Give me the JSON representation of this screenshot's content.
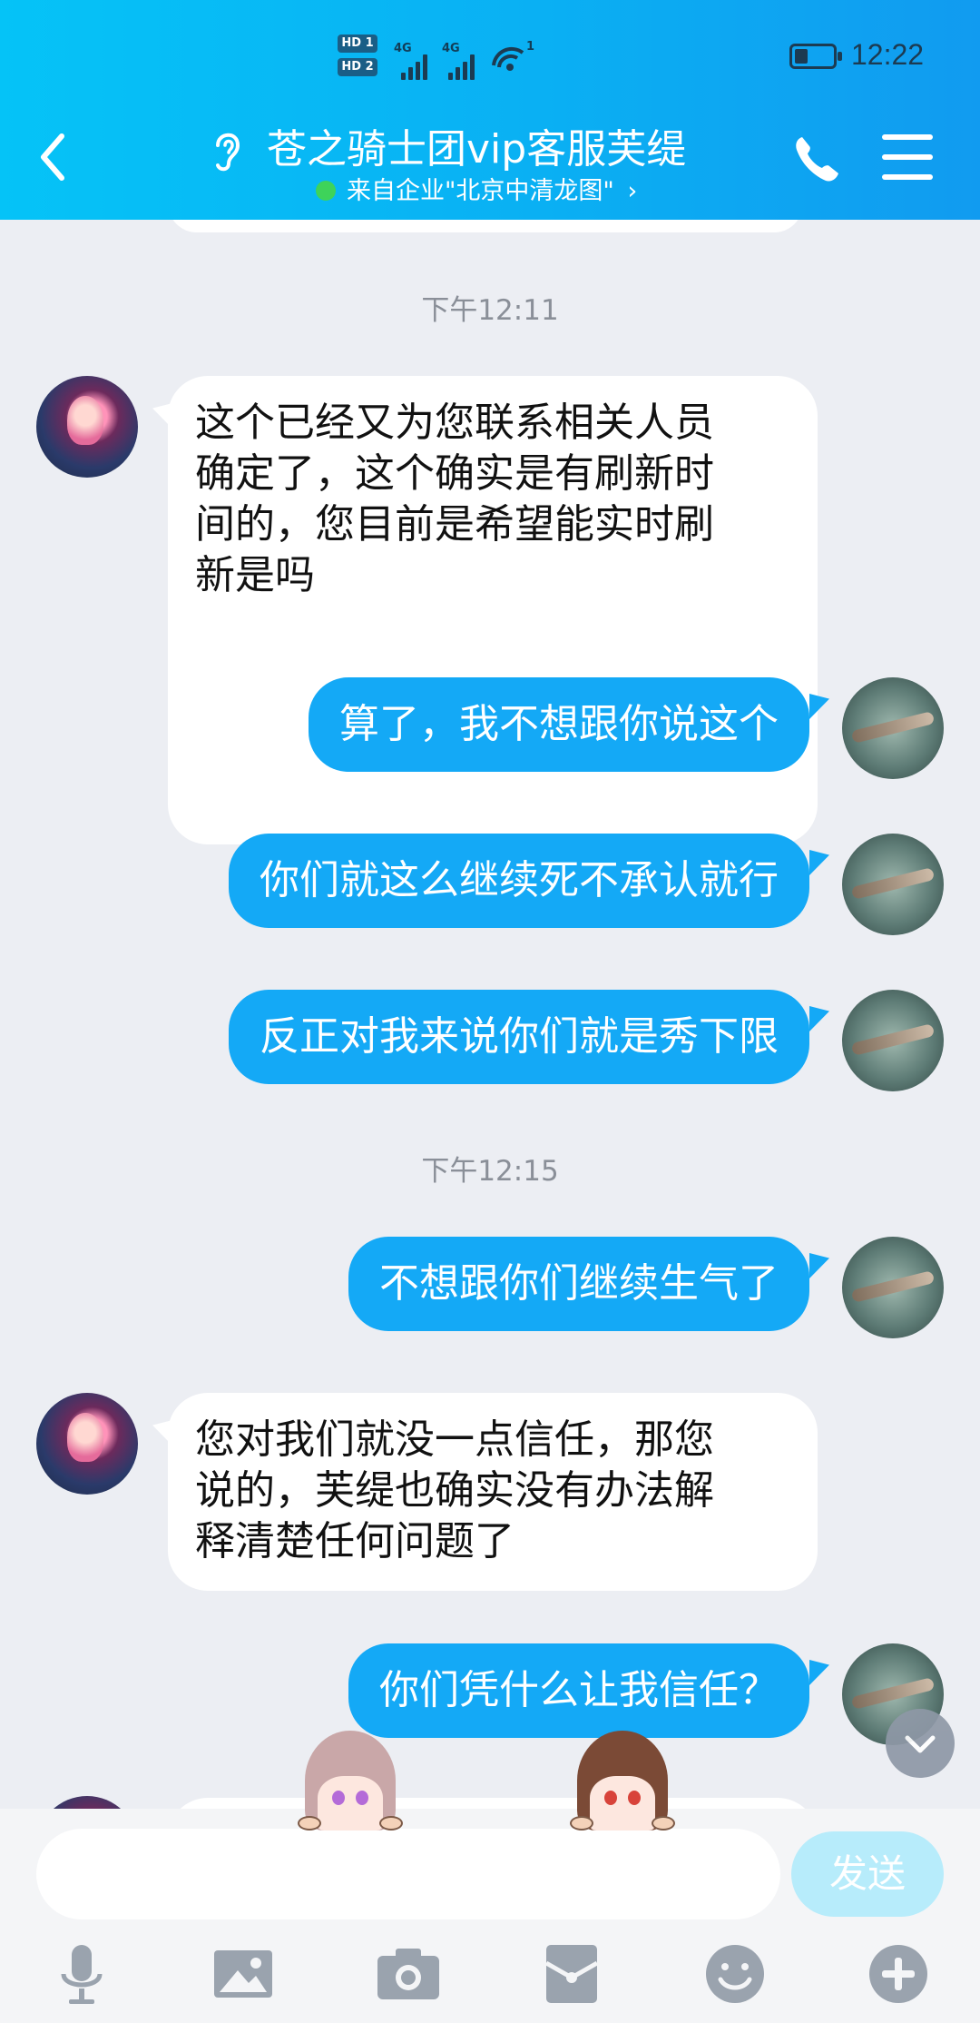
{
  "status_bar": {
    "sim1": "HD 1",
    "sim2": "HD 2",
    "net1": "4G",
    "net2": "4G",
    "hotspot_count": "1",
    "battery_level": 0.35,
    "time": "12:22"
  },
  "header": {
    "title": "苍之骑士团vip客服芙缇",
    "subtitle": "来自企业\"北京中清龙图\"",
    "subtitle_chevron": "›",
    "colors": {
      "gradient_start": "#05c3f7",
      "gradient_end": "#119bf0",
      "online": "#3ed35a"
    },
    "icons": [
      "back-icon",
      "ear-icon",
      "phone-icon",
      "menu-icon"
    ]
  },
  "chat": {
    "timestamps": [
      "下午12:11",
      "下午12:15"
    ],
    "messages": [
      {
        "sender": "agent",
        "lines": [
          "这个已经又为您联系相关人员",
          "确定了，这个确实是有刷新时",
          "间的，您目前是希望能实时刷",
          "新是吗"
        ]
      },
      {
        "sender": "user",
        "text": "算了，我不想跟你说这个"
      },
      {
        "sender": "user",
        "text": "你们就这么继续死不承认就行"
      },
      {
        "sender": "user",
        "text": "反正对我来说你们就是秀下限"
      },
      {
        "sender": "user",
        "text": "不想跟你们继续生气了"
      },
      {
        "sender": "agent",
        "lines": [
          "您对我们就没一点信任，那您",
          "说的，芙缇也确实没有办法解",
          "释清楚任何问题了"
        ]
      },
      {
        "sender": "user",
        "text": "你们凭什么让我信任？"
      }
    ],
    "colors": {
      "incoming_bubble": "#ffffff",
      "outgoing_bubble": "#14a9f6",
      "background": "#eceef3"
    }
  },
  "input_bar": {
    "value": "",
    "send_label": "发送",
    "tools": [
      "microphone-icon",
      "image-icon",
      "camera-icon",
      "red-packet-icon",
      "emoji-icon",
      "plus-icon"
    ]
  }
}
